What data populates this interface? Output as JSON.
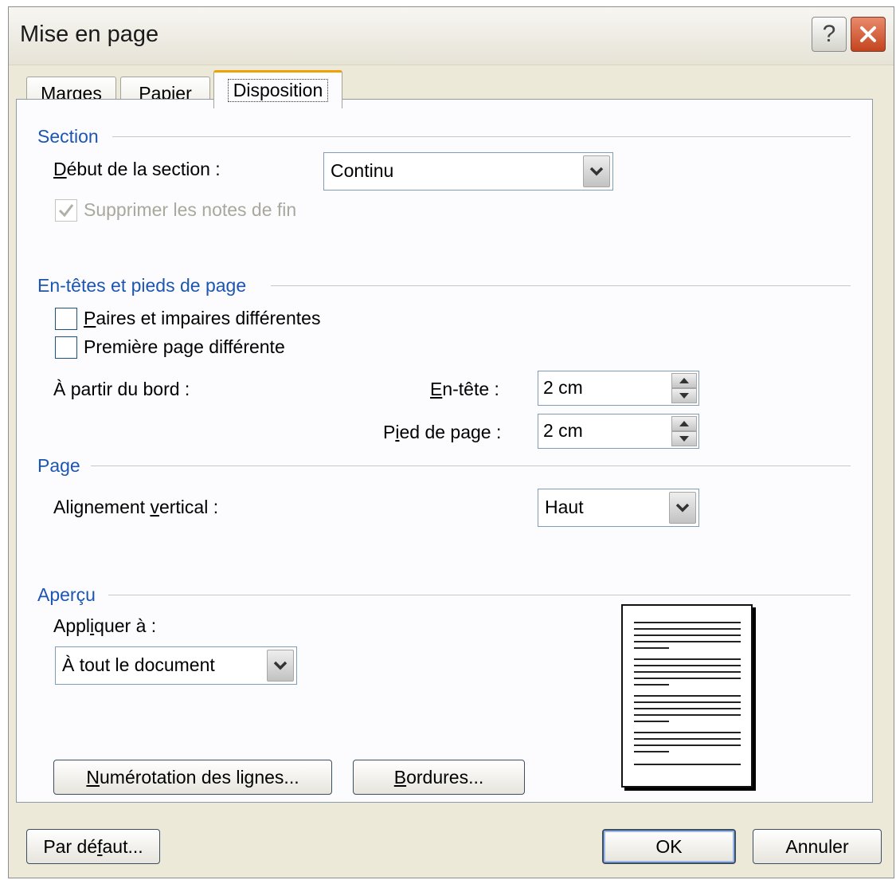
{
  "window": {
    "title": "Mise en page"
  },
  "title_buttons": {
    "help": "?"
  },
  "tabs": [
    {
      "label": "Marges"
    },
    {
      "label": "Papier"
    },
    {
      "label": "Disposition"
    }
  ],
  "section": {
    "group_label": "Section",
    "start_label_underlined": "D",
    "start_label_rest": "ébut de la section :",
    "start_value": "Continu",
    "suppress_endnotes_label": "Supprimer les notes de fin",
    "suppress_endnotes_checked": true
  },
  "headers_footers": {
    "group_label": "En-têtes et pieds de page",
    "odd_even_underlined": "P",
    "odd_even_rest": "aires et impaires différentes",
    "first_page_a": "Première pa",
    "first_page_u": "g",
    "first_page_b": "e différente",
    "from_edge_label": "À partir du bord :",
    "header_u": "E",
    "header_rest": "n-tête :",
    "header_value": "2 cm",
    "footer_a": "P",
    "footer_u": "i",
    "footer_b": "ed de page :",
    "footer_value": "2 cm"
  },
  "page": {
    "group_label": "Page",
    "valign_a": "Alignement ",
    "valign_u": "v",
    "valign_b": "ertical :",
    "valign_value": "Haut"
  },
  "preview": {
    "group_label": "Aperçu",
    "apply_a": "Appl",
    "apply_u": "i",
    "apply_b": "quer à :",
    "apply_value": "À tout le document"
  },
  "buttons": {
    "line_numbers_u": "N",
    "line_numbers_rest": "umérotation des lignes...",
    "borders_u": "B",
    "borders_rest": "ordures...",
    "default_a": "Par dé",
    "default_u": "f",
    "default_b": "aut...",
    "ok": "OK",
    "cancel": "Annuler"
  }
}
